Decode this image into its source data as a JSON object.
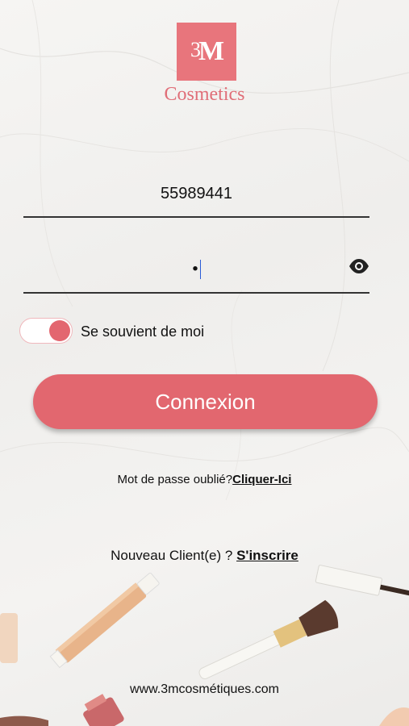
{
  "brand": {
    "logo_mark": "3M",
    "logo_digit": "3",
    "logo_letter": "M",
    "name": "Cosmetics",
    "accent": "#e2676f"
  },
  "login": {
    "phone_value": "55989441",
    "password_masked": "•",
    "show_password_icon": "eye-icon",
    "remember_label": "Se souvient de moi",
    "remember_on": true,
    "submit_label": "Connexion"
  },
  "forgot": {
    "text": "Mot de passe oublié?",
    "link": "Cliquer-Ici"
  },
  "register": {
    "text": "Nouveau Client(e) ?",
    "link": "S'inscrire"
  },
  "footer": {
    "website": "www.3mcosmétiques.com"
  }
}
